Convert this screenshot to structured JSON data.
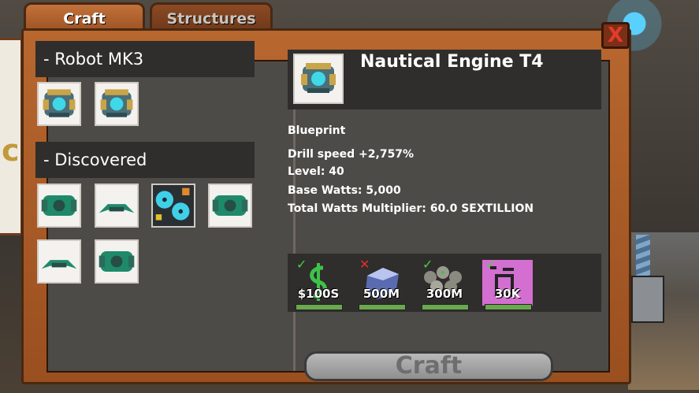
{
  "tabs": {
    "craft": "Craft",
    "structures": "Structures"
  },
  "close_label": "X",
  "sections": {
    "robot": "- Robot MK3",
    "discovered": "- Discovered"
  },
  "detail": {
    "title": "Nautical Engine T4",
    "type": "Blueprint",
    "drill_speed": "Drill speed +2,757%",
    "level": "Level: 40",
    "base_watts": "Base Watts: 5,000",
    "multiplier": "Total Watts Multiplier: 60.0 SEXTILLION"
  },
  "requirements": [
    {
      "icon": "cash-icon",
      "amount": "$100S",
      "status": "met"
    },
    {
      "icon": "ice-block-icon",
      "amount": "500M",
      "status": "missing"
    },
    {
      "icon": "ore-pile-icon",
      "amount": "300M",
      "status": "met"
    },
    {
      "icon": "circuit-chip-icon",
      "amount": "30K",
      "status": "met"
    }
  ],
  "craft_button": "Craft",
  "colors": {
    "accent_wood": "#b8672f",
    "ok": "#49d23a",
    "error": "#e0312a"
  }
}
